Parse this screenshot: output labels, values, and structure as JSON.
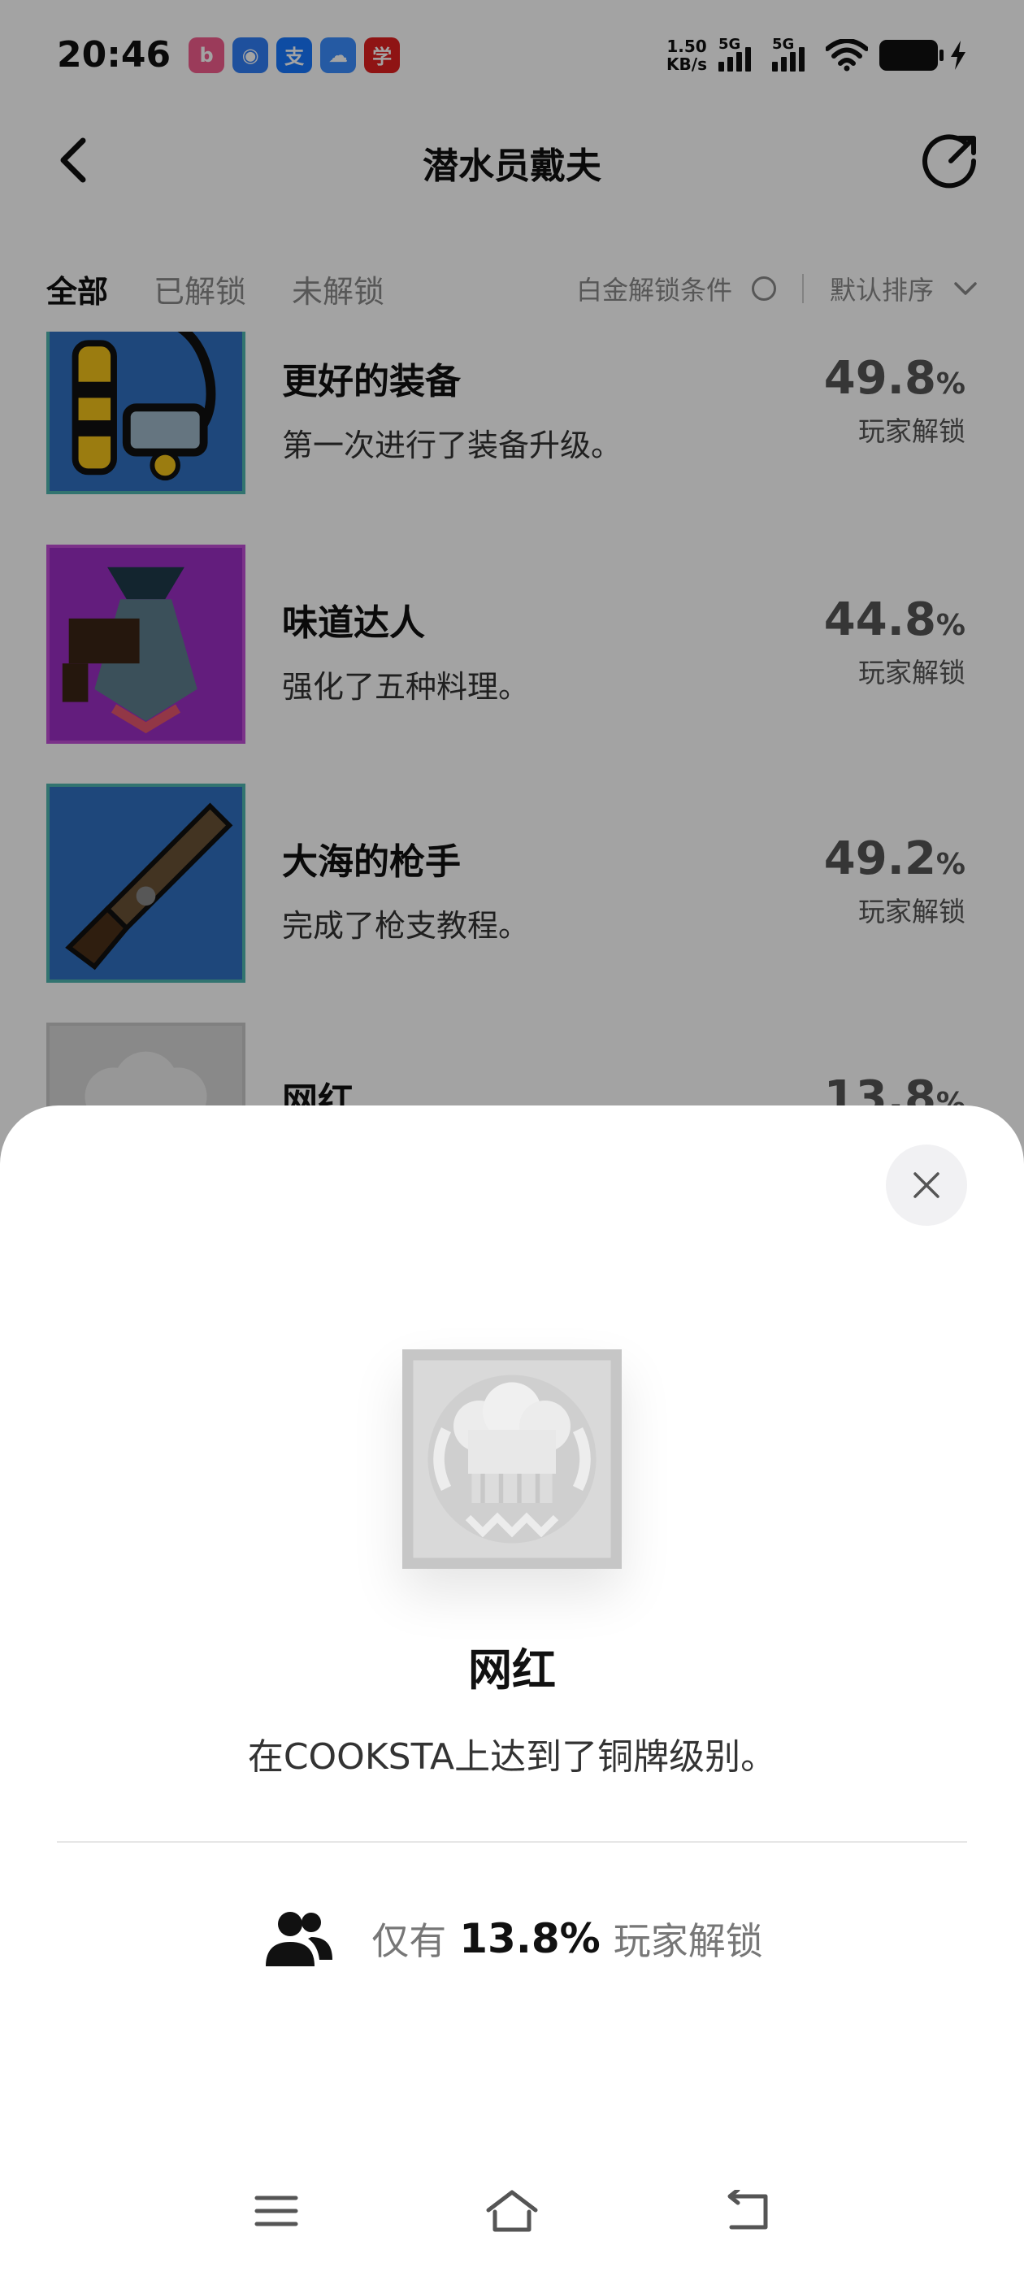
{
  "status": {
    "time": "20:46",
    "apps": [
      {
        "name": "bilibili-icon",
        "color": "#f25d8e",
        "glyph": "b"
      },
      {
        "name": "message-app-icon",
        "color": "#2f7df6",
        "glyph": "◉"
      },
      {
        "name": "alipay-icon",
        "color": "#1677ff",
        "glyph": "支"
      },
      {
        "name": "cloud-app-icon",
        "color": "#3a8dff",
        "glyph": "☁"
      },
      {
        "name": "xuexi-app-icon",
        "color": "#e02020",
        "glyph": "学"
      }
    ],
    "net_speed_value": "1.50",
    "net_speed_unit": "KB/s",
    "signal1_label": "5G",
    "signal2_label": "5G"
  },
  "header": {
    "title": "潜水员戴夫"
  },
  "tabs": [
    {
      "label": "全部",
      "active": true
    },
    {
      "label": "已解锁",
      "active": false
    },
    {
      "label": "未解锁",
      "active": false
    }
  ],
  "filters": {
    "platinum_label": "白金解锁条件",
    "sort_label": "默认排序"
  },
  "achievements": [
    {
      "name": "更好的装备",
      "desc": "第一次进行了装备升级。",
      "pct": "49.8",
      "unit": "%",
      "label": "玩家解锁",
      "icon": "diving-gear-icon"
    },
    {
      "name": "味道达人",
      "desc": "强化了五种料理。",
      "pct": "44.8",
      "unit": "%",
      "label": "玩家解锁",
      "icon": "fish-dish-icon"
    },
    {
      "name": "大海的枪手",
      "desc": "完成了枪支教程。",
      "pct": "49.2",
      "unit": "%",
      "label": "玩家解锁",
      "icon": "harpoon-gun-icon"
    },
    {
      "name": "网红",
      "desc": "",
      "pct": "13.8",
      "unit": "%",
      "label": "",
      "icon": "chef-hat-icon"
    }
  ],
  "sheet": {
    "title": "网红",
    "desc": "在COOKSTA上达到了铜牌级别。",
    "stat_prefix": "仅有",
    "stat_value": "13.8%",
    "stat_suffix": "玩家解锁"
  },
  "colors": {
    "accent": "#111111",
    "muted": "#888888",
    "frame_teal": "#4fb6b0"
  }
}
